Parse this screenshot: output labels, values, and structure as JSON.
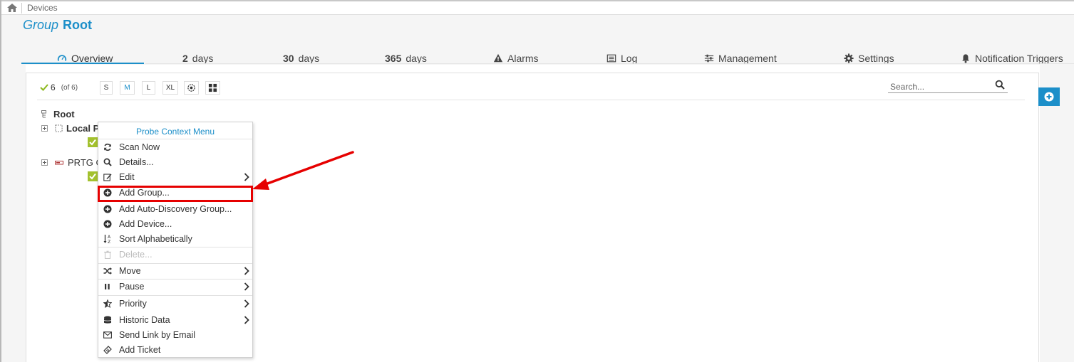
{
  "breadcrumb": {
    "home_icon": "home-icon",
    "label": "Devices"
  },
  "page": {
    "title_prefix": "Group",
    "title_name": "Root"
  },
  "tabs": [
    {
      "label": "Overview",
      "icon": "gauge-icon",
      "active": true
    },
    {
      "num": "2",
      "label": "days"
    },
    {
      "num": "30",
      "label": "days"
    },
    {
      "num": "365",
      "label": "days"
    },
    {
      "label": "Alarms",
      "icon": "warning-icon"
    },
    {
      "label": "Log",
      "icon": "list-icon"
    },
    {
      "label": "Management",
      "icon": "sliders-icon"
    },
    {
      "label": "Settings",
      "icon": "gear-icon"
    },
    {
      "label": "Notification Triggers",
      "icon": "bell-icon"
    }
  ],
  "toolbar": {
    "count": "6",
    "count_of": "(of 6)",
    "sizes": [
      "S",
      "M",
      "L",
      "XL"
    ],
    "active_size": "M",
    "search_placeholder": "Search..."
  },
  "tree": {
    "root": "Root",
    "nodes": [
      "Local P",
      "PRTG C"
    ]
  },
  "context_menu": {
    "title": "Probe Context Menu",
    "items": [
      {
        "label": "Scan Now",
        "icon": "refresh-icon"
      },
      {
        "label": "Details...",
        "icon": "search-icon"
      },
      {
        "label": "Edit",
        "icon": "edit-icon",
        "submenu": true
      },
      {
        "label": "Add Group...",
        "icon": "plus-circle-icon",
        "highlighted": true
      },
      {
        "label": "Add Auto-Discovery Group...",
        "icon": "plus-circle-icon"
      },
      {
        "label": "Add Device...",
        "icon": "plus-circle-icon"
      },
      {
        "label": "Sort Alphabetically",
        "icon": "sort-alpha-icon"
      },
      {
        "label": "Delete...",
        "icon": "trash-icon",
        "disabled": true
      },
      {
        "label": "Move",
        "icon": "shuffle-icon",
        "submenu": true
      },
      {
        "label": "Pause",
        "icon": "pause-icon",
        "submenu": true
      },
      {
        "label": "Priority",
        "icon": "star-half-icon",
        "submenu": true
      },
      {
        "label": "Historic Data",
        "icon": "database-icon",
        "submenu": true
      },
      {
        "label": "Send Link by Email",
        "icon": "envelope-icon"
      },
      {
        "label": "Add Ticket",
        "icon": "ticket-icon"
      }
    ]
  },
  "colors": {
    "accent": "#1c8fc9",
    "ok": "#a3c12e",
    "annotation": "#e60000"
  }
}
